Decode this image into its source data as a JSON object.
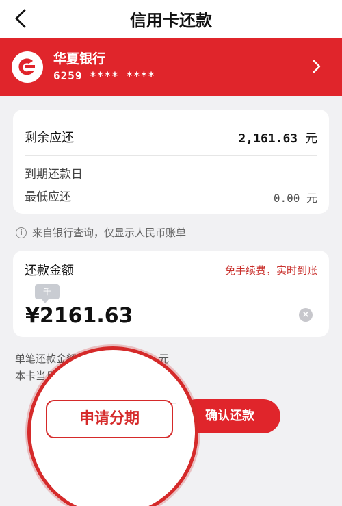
{
  "nav": {
    "title": "信用卡还款"
  },
  "bank": {
    "name": "华夏银行",
    "card": "6259 **** ****"
  },
  "summary": {
    "remaining_label": "剩余应还",
    "remaining_value": "2,161.63",
    "currency_unit": "元",
    "due_label": "到期还款日",
    "min_label": "最低应还",
    "min_value": "0.00"
  },
  "notice": "来自银行查询，仅显示人民币账单",
  "amount": {
    "label": "还款金额",
    "fee_note": "免手续费，实时到账",
    "unit_badge": "千",
    "value": "¥2161.63"
  },
  "hints": {
    "line1": "单笔还款金额",
    "line1_tail": "元",
    "line2": "本卡当月"
  },
  "buttons": {
    "installment": "申请分期",
    "confirm": "确认还款"
  },
  "colors": {
    "brand_red": "#e0252b",
    "accent_red": "#d52a2a"
  }
}
